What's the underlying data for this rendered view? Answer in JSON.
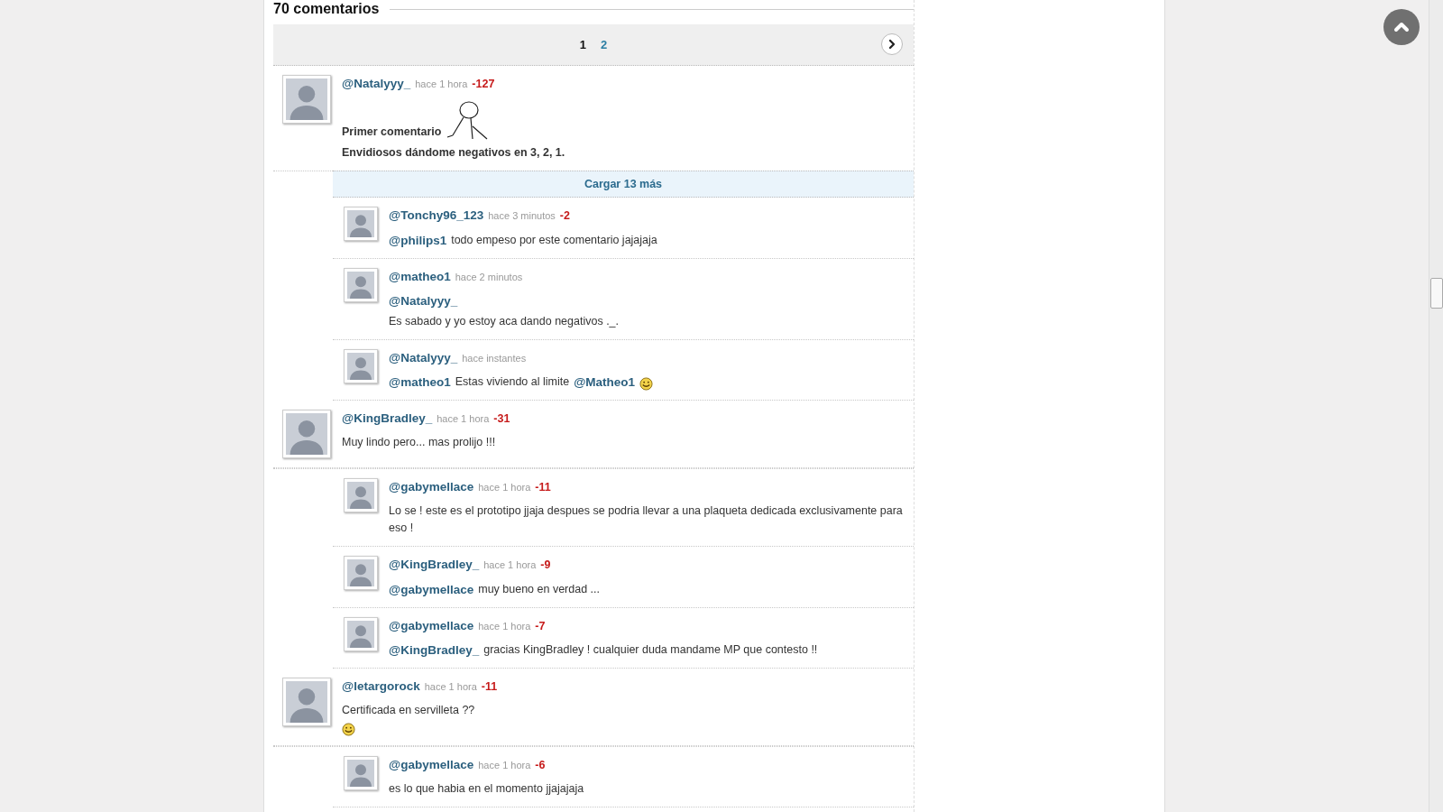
{
  "heading": "70 comentarios",
  "pager": {
    "pages": [
      {
        "label": "1",
        "selected": true
      },
      {
        "label": "2",
        "selected": false
      }
    ]
  },
  "comments": [
    {
      "user": "@Natalyyy_",
      "time": "hace 1 hora",
      "score": "-127",
      "bold": true,
      "body": [
        [
          {
            "kind": "text",
            "text": "Primer comentario"
          },
          {
            "kind": "meme"
          }
        ],
        [
          {
            "kind": "text",
            "text": "Envidiosos dándome negativos en 3, 2, 1."
          }
        ]
      ],
      "load_more": "Cargar 13 más",
      "replies": [
        {
          "user": "@Tonchy96_123",
          "time": "hace 3 minutos",
          "score": "-2",
          "body": [
            [
              {
                "kind": "mention",
                "text": "@philips1"
              },
              {
                "kind": "text",
                "text": "todo empeso por este comentario jajajaja"
              }
            ]
          ]
        },
        {
          "user": "@matheo1",
          "time": "hace 2 minutos",
          "body": [
            [
              {
                "kind": "mention",
                "text": "@Natalyyy_"
              }
            ],
            [
              {
                "kind": "text",
                "text": "Es sabado y yo estoy aca dando negativos ._."
              }
            ]
          ]
        },
        {
          "user": "@Natalyyy_",
          "time": "hace instantes",
          "body": [
            [
              {
                "kind": "mention",
                "text": "@matheo1"
              },
              {
                "kind": "text",
                "text": "Estas viviendo al limite"
              },
              {
                "kind": "mention",
                "text": "@Matheo1"
              },
              {
                "kind": "emoji"
              }
            ]
          ]
        }
      ]
    },
    {
      "user": "@KingBradley_",
      "time": "hace 1 hora",
      "score": "-31",
      "bold": false,
      "body": [
        [
          {
            "kind": "text",
            "text": "Muy lindo pero... mas prolijo !!!"
          }
        ]
      ],
      "replies": [
        {
          "user": "@gabymellace",
          "time": "hace 1 hora",
          "score": "-11",
          "body": [
            [
              {
                "kind": "text",
                "text": "Lo se ! este es el prototipo jjaja despues se podria llevar a una plaqueta dedicada exclusivamente para eso !"
              }
            ]
          ]
        },
        {
          "user": "@KingBradley_",
          "time": "hace 1 hora",
          "score": "-9",
          "body": [
            [
              {
                "kind": "mention",
                "text": "@gabymellace"
              },
              {
                "kind": "text",
                "text": "muy bueno en verdad ..."
              }
            ]
          ]
        },
        {
          "user": "@gabymellace",
          "time": "hace 1 hora",
          "score": "-7",
          "body": [
            [
              {
                "kind": "mention",
                "text": "@KingBradley_"
              },
              {
                "kind": "text",
                "text": "gracias KingBradley ! cualquier duda mandame MP que contesto !!"
              }
            ]
          ]
        }
      ]
    },
    {
      "user": "@letargorock",
      "time": "hace 1 hora",
      "score": "-11",
      "bold": false,
      "body": [
        [
          {
            "kind": "text",
            "text": "Certificada en servilleta ??"
          }
        ],
        [
          {
            "kind": "emoji"
          }
        ]
      ],
      "replies": [
        {
          "user": "@gabymellace",
          "time": "hace 1 hora",
          "score": "-6",
          "body": [
            [
              {
                "kind": "text",
                "text": "es lo que habia en el momento jjajajaja"
              }
            ]
          ]
        }
      ]
    }
  ]
}
